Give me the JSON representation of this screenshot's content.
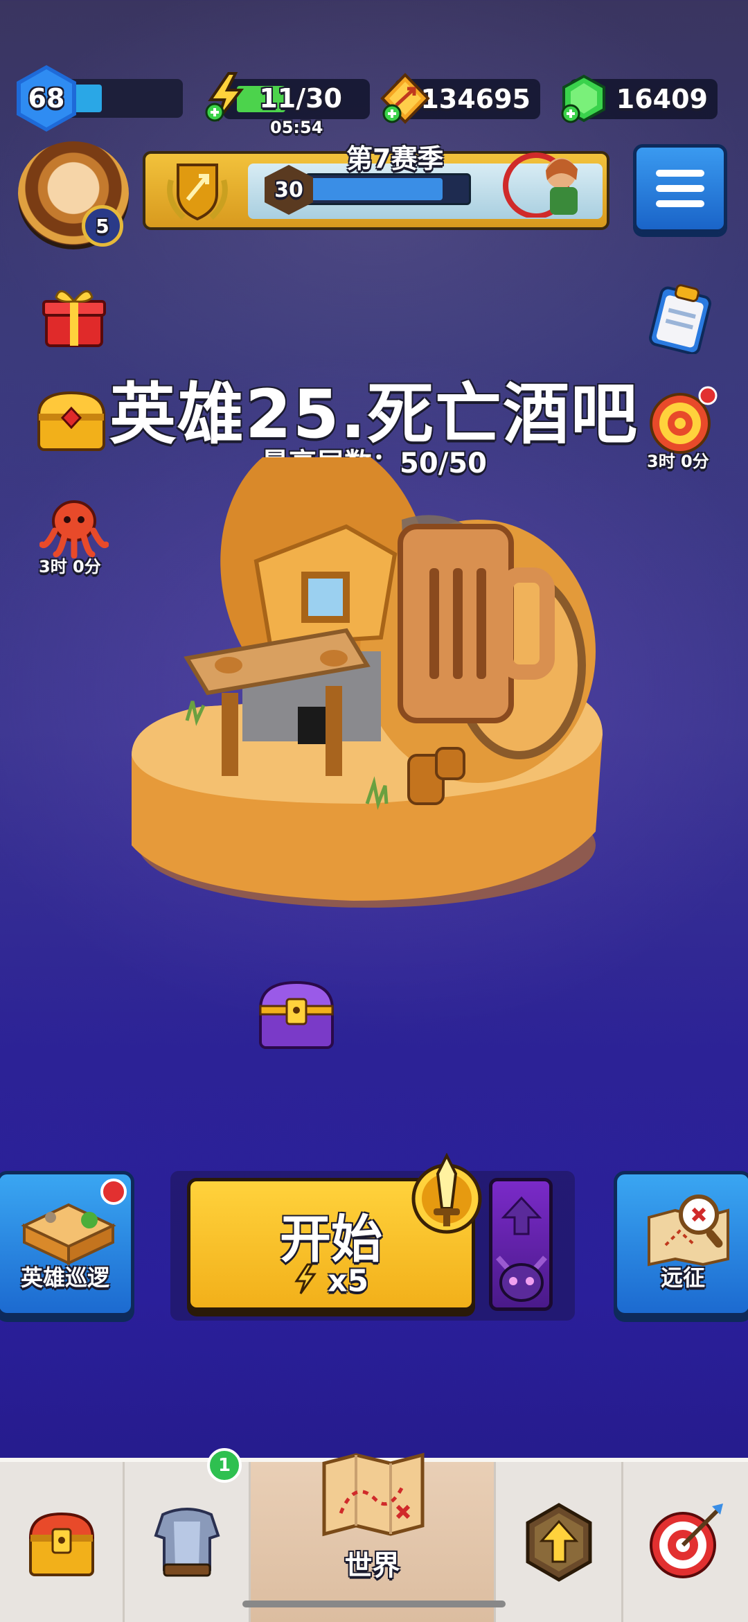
{
  "player": {
    "level": "68",
    "xp_progress": 0.3,
    "avatar_level": "5"
  },
  "resources": {
    "energy": "11/30",
    "energy_progress": 0.37,
    "energy_timer": "05:54",
    "gold": "134695",
    "gems": "16409"
  },
  "season": {
    "title": "第7赛季",
    "level": "30",
    "progress": 0.85
  },
  "side_left": [
    {
      "name": "gift-icon"
    },
    {
      "name": "treasure-chest-icon"
    },
    {
      "name": "octopus-event-icon",
      "timer": "3时 0分"
    }
  ],
  "side_right": [
    {
      "name": "clipboard-quest-icon"
    },
    {
      "name": "dartboard-event-icon",
      "timer": "3时 0分"
    }
  ],
  "stage": {
    "title": "英雄25.死亡酒吧",
    "best_floor": "最高层数：50/50"
  },
  "actions": {
    "left_mode": "英雄巡逻",
    "start_label": "开始",
    "start_cost": "x5",
    "right_mode": "远征"
  },
  "nav": {
    "items": [
      {
        "name": "shop",
        "icon": "chest-icon"
      },
      {
        "name": "equipment",
        "icon": "armor-icon",
        "badge": "1"
      },
      {
        "name": "world",
        "icon": "map-icon",
        "label": "世界"
      },
      {
        "name": "upgrade",
        "icon": "upgrade-arrow-icon"
      },
      {
        "name": "events",
        "icon": "target-icon"
      }
    ]
  },
  "colors": {
    "accent_gold": "#f2b01a",
    "accent_blue": "#2a8ae6",
    "energy_green": "#4cd34c",
    "background_purple": "#2c2296"
  }
}
